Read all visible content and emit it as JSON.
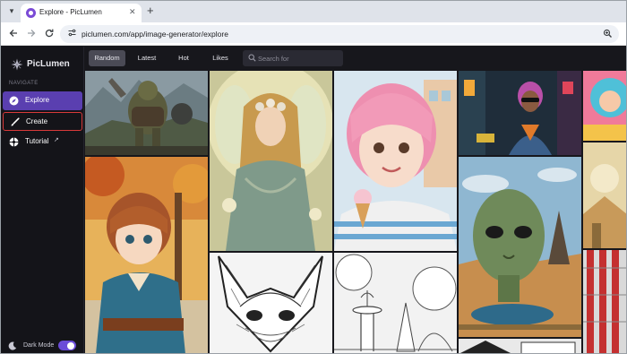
{
  "browser": {
    "tab_title": "Explore - PicLumen",
    "tab_close": "✕",
    "new_tab": "+",
    "url": "piclumen.com/app/image-generator/explore",
    "icons": [
      "tab-list-icon",
      "back-icon",
      "forward-icon",
      "reload-icon",
      "site-info-icon",
      "zoom-icon"
    ]
  },
  "app": {
    "name": "PicLumen",
    "accent": "#5a3fb0",
    "highlight": "#d93a3a"
  },
  "sidebar": {
    "section_label": "NAVIGATE",
    "items": [
      {
        "label": "Explore",
        "icon": "compass-icon",
        "active": true
      },
      {
        "label": "Create",
        "icon": "brush-icon",
        "active": false
      },
      {
        "label": "Tutorial",
        "icon": "tutorial-icon",
        "external": "↗"
      }
    ],
    "dark_mode": {
      "label": "Dark Mode",
      "enabled": true
    }
  },
  "filters": {
    "tabs": [
      "Random",
      "Latest",
      "Hot",
      "Likes"
    ],
    "selected": "Random",
    "search_placeholder": "Search for"
  },
  "gallery": {
    "items": [
      {
        "subject": "armored orc warrior in mountain landscape"
      },
      {
        "subject": "anime girl with auburn hair in autumn park"
      },
      {
        "subject": "fairy woman with floral crown in forest"
      },
      {
        "subject": "fox face line-art coloring page"
      },
      {
        "subject": "pink-haired girl holding ice cream cone"
      },
      {
        "subject": "fountain and trees line-art coloring page"
      },
      {
        "subject": "woman with sunglasses in neon city street"
      },
      {
        "subject": "surreal green alien head in landscape"
      },
      {
        "subject": "colorful painted portrait"
      },
      {
        "subject": "colorful surreal scene"
      },
      {
        "subject": "red building facade"
      }
    ]
  }
}
